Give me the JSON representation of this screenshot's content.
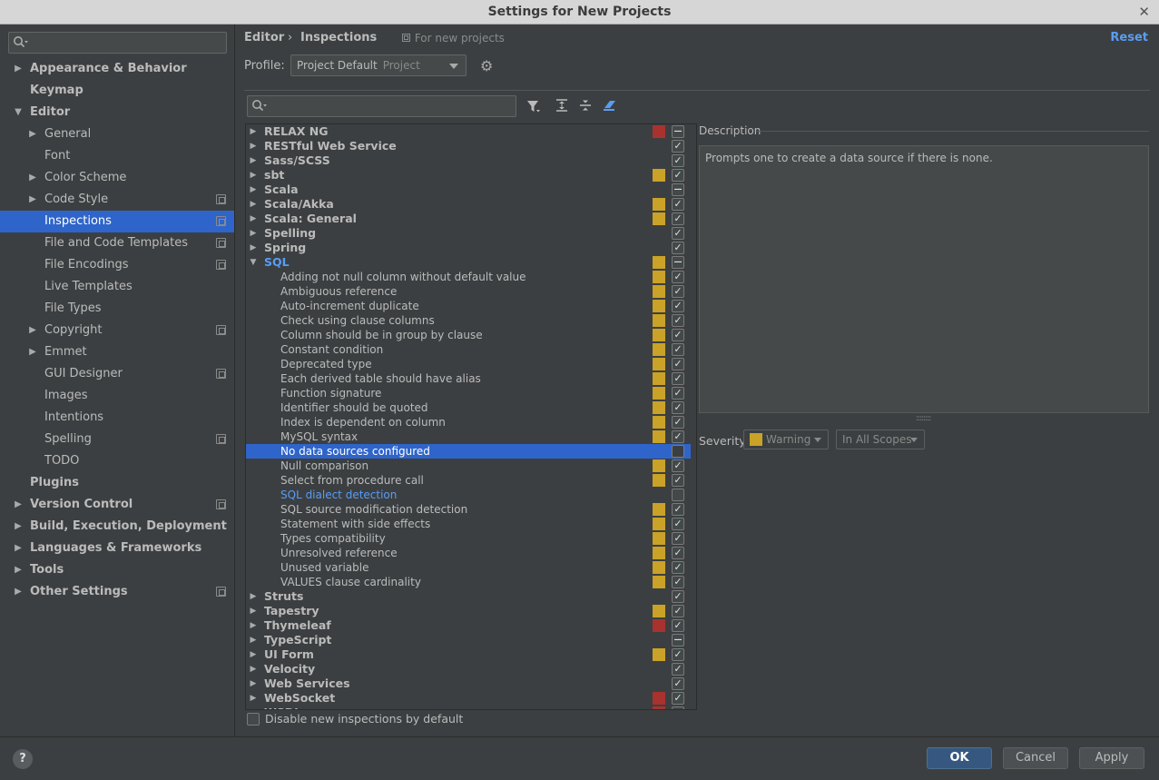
{
  "window": {
    "title": "Settings for New Projects",
    "close_glyph": "✕"
  },
  "sidebar": {
    "search_placeholder": "",
    "items": [
      {
        "label": "Appearance & Behavior",
        "level": 0,
        "arrow": "right",
        "bold": true
      },
      {
        "label": "Keymap",
        "level": 0,
        "arrow": "none",
        "bold": true
      },
      {
        "label": "Editor",
        "level": 0,
        "arrow": "down",
        "bold": true
      },
      {
        "label": "General",
        "level": 1,
        "arrow": "right"
      },
      {
        "label": "Font",
        "level": 1,
        "arrow": "none"
      },
      {
        "label": "Color Scheme",
        "level": 1,
        "arrow": "right"
      },
      {
        "label": "Code Style",
        "level": 1,
        "arrow": "right",
        "copy": true
      },
      {
        "label": "Inspections",
        "level": 1,
        "arrow": "none",
        "copy": true,
        "selected": true
      },
      {
        "label": "File and Code Templates",
        "level": 1,
        "arrow": "none",
        "copy": true
      },
      {
        "label": "File Encodings",
        "level": 1,
        "arrow": "none",
        "copy": true
      },
      {
        "label": "Live Templates",
        "level": 1,
        "arrow": "none"
      },
      {
        "label": "File Types",
        "level": 1,
        "arrow": "none"
      },
      {
        "label": "Copyright",
        "level": 1,
        "arrow": "right",
        "copy": true
      },
      {
        "label": "Emmet",
        "level": 1,
        "arrow": "right"
      },
      {
        "label": "GUI Designer",
        "level": 1,
        "arrow": "none",
        "copy": true
      },
      {
        "label": "Images",
        "level": 1,
        "arrow": "none"
      },
      {
        "label": "Intentions",
        "level": 1,
        "arrow": "none"
      },
      {
        "label": "Spelling",
        "level": 1,
        "arrow": "none",
        "copy": true
      },
      {
        "label": "TODO",
        "level": 1,
        "arrow": "none"
      },
      {
        "label": "Plugins",
        "level": 0,
        "arrow": "none",
        "bold": true
      },
      {
        "label": "Version Control",
        "level": 0,
        "arrow": "right",
        "bold": true,
        "copy": true
      },
      {
        "label": "Build, Execution, Deployment",
        "level": 0,
        "arrow": "right",
        "bold": true
      },
      {
        "label": "Languages & Frameworks",
        "level": 0,
        "arrow": "right",
        "bold": true
      },
      {
        "label": "Tools",
        "level": 0,
        "arrow": "right",
        "bold": true
      },
      {
        "label": "Other Settings",
        "level": 0,
        "arrow": "right",
        "bold": true,
        "copy": true
      }
    ]
  },
  "header": {
    "breadcrumb_editor": "Editor",
    "breadcrumb_sep": "›",
    "breadcrumb_current": "Inspections",
    "scope_note": "For new projects",
    "reset_label": "Reset",
    "profile_label": "Profile:",
    "profile_value": "Project Default",
    "profile_kind": "Project"
  },
  "inspections": {
    "search_placeholder": "",
    "rows": [
      {
        "label": "RELAX NG",
        "group": true,
        "arrow": "right",
        "sev": "#a8322e",
        "check": "partial"
      },
      {
        "label": "RESTful Web Service",
        "group": true,
        "arrow": "right",
        "sev": "",
        "check": "checked"
      },
      {
        "label": "Sass/SCSS",
        "group": true,
        "arrow": "right",
        "sev": "",
        "check": "checked"
      },
      {
        "label": "sbt",
        "group": true,
        "arrow": "right",
        "sev": "#c9a227",
        "check": "checked"
      },
      {
        "label": "Scala",
        "group": true,
        "arrow": "right",
        "sev": "",
        "check": "partial"
      },
      {
        "label": "Scala/Akka",
        "group": true,
        "arrow": "right",
        "sev": "#c9a227",
        "check": "checked"
      },
      {
        "label": "Scala: General",
        "group": true,
        "arrow": "right",
        "sev": "#c9a227",
        "check": "checked"
      },
      {
        "label": "Spelling",
        "group": true,
        "arrow": "right",
        "sev": "",
        "check": "checked"
      },
      {
        "label": "Spring",
        "group": true,
        "arrow": "right",
        "sev": "",
        "check": "checked"
      },
      {
        "label": "SQL",
        "group": true,
        "arrow": "down",
        "sev": "#c9a227",
        "check": "partial",
        "link": true
      },
      {
        "label": "Adding not null column without default value",
        "sev": "#c9a227",
        "check": "checked"
      },
      {
        "label": "Ambiguous reference",
        "sev": "#c9a227",
        "check": "checked"
      },
      {
        "label": "Auto-increment duplicate",
        "sev": "#c9a227",
        "check": "checked"
      },
      {
        "label": "Check using clause columns",
        "sev": "#c9a227",
        "check": "checked"
      },
      {
        "label": "Column should be in group by clause",
        "sev": "#c9a227",
        "check": "checked"
      },
      {
        "label": "Constant condition",
        "sev": "#c9a227",
        "check": "checked"
      },
      {
        "label": "Deprecated type",
        "sev": "#c9a227",
        "check": "checked"
      },
      {
        "label": "Each derived table should have alias",
        "sev": "#c9a227",
        "check": "checked"
      },
      {
        "label": "Function signature",
        "sev": "#c9a227",
        "check": "checked"
      },
      {
        "label": "Identifier should be quoted",
        "sev": "#c9a227",
        "check": "checked"
      },
      {
        "label": "Index is dependent on column",
        "sev": "#c9a227",
        "check": "checked"
      },
      {
        "label": "MySQL syntax",
        "sev": "#c9a227",
        "check": "checked"
      },
      {
        "label": "No data sources configured",
        "sev": "",
        "check": "unchecked",
        "selected": true
      },
      {
        "label": "Null comparison",
        "sev": "#c9a227",
        "check": "checked"
      },
      {
        "label": "Select from procedure call",
        "sev": "#c9a227",
        "check": "checked"
      },
      {
        "label": "SQL dialect detection",
        "sev": "",
        "check": "unchecked",
        "link": true
      },
      {
        "label": "SQL source modification detection",
        "sev": "#c9a227",
        "check": "checked"
      },
      {
        "label": "Statement with side effects",
        "sev": "#c9a227",
        "check": "checked"
      },
      {
        "label": "Types compatibility",
        "sev": "#c9a227",
        "check": "checked"
      },
      {
        "label": "Unresolved reference",
        "sev": "#c9a227",
        "check": "checked"
      },
      {
        "label": "Unused variable",
        "sev": "#c9a227",
        "check": "checked"
      },
      {
        "label": "VALUES clause cardinality",
        "sev": "#c9a227",
        "check": "checked"
      },
      {
        "label": "Struts",
        "group": true,
        "arrow": "right",
        "sev": "",
        "check": "checked"
      },
      {
        "label": "Tapestry",
        "group": true,
        "arrow": "right",
        "sev": "#c9a227",
        "check": "checked"
      },
      {
        "label": "Thymeleaf",
        "group": true,
        "arrow": "right",
        "sev": "#a8322e",
        "check": "checked"
      },
      {
        "label": "TypeScript",
        "group": true,
        "arrow": "right",
        "sev": "",
        "check": "partial"
      },
      {
        "label": "UI Form",
        "group": true,
        "arrow": "right",
        "sev": "#c9a227",
        "check": "checked"
      },
      {
        "label": "Velocity",
        "group": true,
        "arrow": "right",
        "sev": "",
        "check": "checked"
      },
      {
        "label": "Web Services",
        "group": true,
        "arrow": "right",
        "sev": "",
        "check": "checked"
      },
      {
        "label": "WebSocket",
        "group": true,
        "arrow": "right",
        "sev": "#a8322e",
        "check": "checked"
      },
      {
        "label": "WSDL",
        "group": true,
        "arrow": "right",
        "sev": "#a8322e",
        "check": "checked"
      }
    ],
    "disable_new_label": "Disable new inspections by default"
  },
  "description": {
    "title": "Description",
    "text": "Prompts one to create a data source if there is none."
  },
  "severity": {
    "label": "Severity:",
    "value": "Warning",
    "scope_value": "In All Scopes"
  },
  "footer": {
    "help_label": "?",
    "ok_label": "OK",
    "cancel_label": "Cancel",
    "apply_label": "Apply"
  },
  "colors": {
    "warning": "#c9a227",
    "error": "#a8322e",
    "selection": "#2f65ca",
    "link": "#589df6"
  }
}
